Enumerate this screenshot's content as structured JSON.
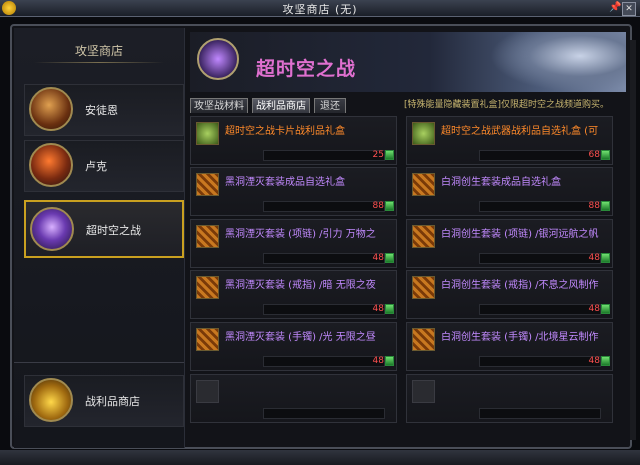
{
  "window": {
    "title": "攻坚商店 (无)"
  },
  "sidebar": {
    "header": "攻坚商店",
    "items": [
      {
        "label": "安徒恩",
        "icon": "anton-portrait-icon"
      },
      {
        "label": "卢克",
        "icon": "luke-portrait-icon"
      },
      {
        "label": "超时空之战",
        "icon": "space-time-war-icon",
        "active": true
      }
    ],
    "bottom": {
      "label": "战利品商店",
      "icon": "treasure-chest-icon"
    }
  },
  "banner": {
    "title": "超时空之战"
  },
  "tabs": [
    {
      "label": "攻坚战材料"
    },
    {
      "label": "战利品商店",
      "active": true
    },
    {
      "label": "退还"
    }
  ],
  "notice": "[特殊能量隐藏装置礼盒]仅限超时空之战频道购买。",
  "items": [
    {
      "name": "超时空之战卡片战利品礼盒",
      "price": "25",
      "color": "orange",
      "icon": "green-box-icon"
    },
    {
      "name": "超时空之战武器战利品自选礼盒 (可",
      "price": "68",
      "color": "orange",
      "icon": "green-box-icon"
    },
    {
      "name": "黑洞湮灭套装成品自选礼盒",
      "price": "88",
      "color": "purple",
      "icon": "orange-box-icon"
    },
    {
      "name": "白洞创生套装成品自选礼盒",
      "price": "88",
      "color": "purple",
      "icon": "orange-box-icon"
    },
    {
      "name": "黑洞湮灭套装 (项链) /引力 万物之",
      "price": "48",
      "color": "purple",
      "icon": "orange-box-icon"
    },
    {
      "name": "白洞创生套装 (项链) /银河远航之帆",
      "price": "48",
      "color": "purple",
      "icon": "orange-box-icon"
    },
    {
      "name": "黑洞湮灭套装 (戒指) /暗 无限之夜",
      "price": "48",
      "color": "purple",
      "icon": "orange-box-icon"
    },
    {
      "name": "白洞创生套装 (戒指) /不息之风制作",
      "price": "48",
      "color": "purple",
      "icon": "orange-box-icon"
    },
    {
      "name": "黑洞湮灭套装 (手镯) /光 无限之昼",
      "price": "48",
      "color": "purple",
      "icon": "orange-box-icon"
    },
    {
      "name": "白洞创生套装 (手镯) /北境星云制作",
      "price": "48",
      "color": "purple",
      "icon": "orange-box-icon"
    },
    {
      "name": "",
      "price": "",
      "empty": true
    },
    {
      "name": "",
      "price": "",
      "empty": true
    }
  ]
}
